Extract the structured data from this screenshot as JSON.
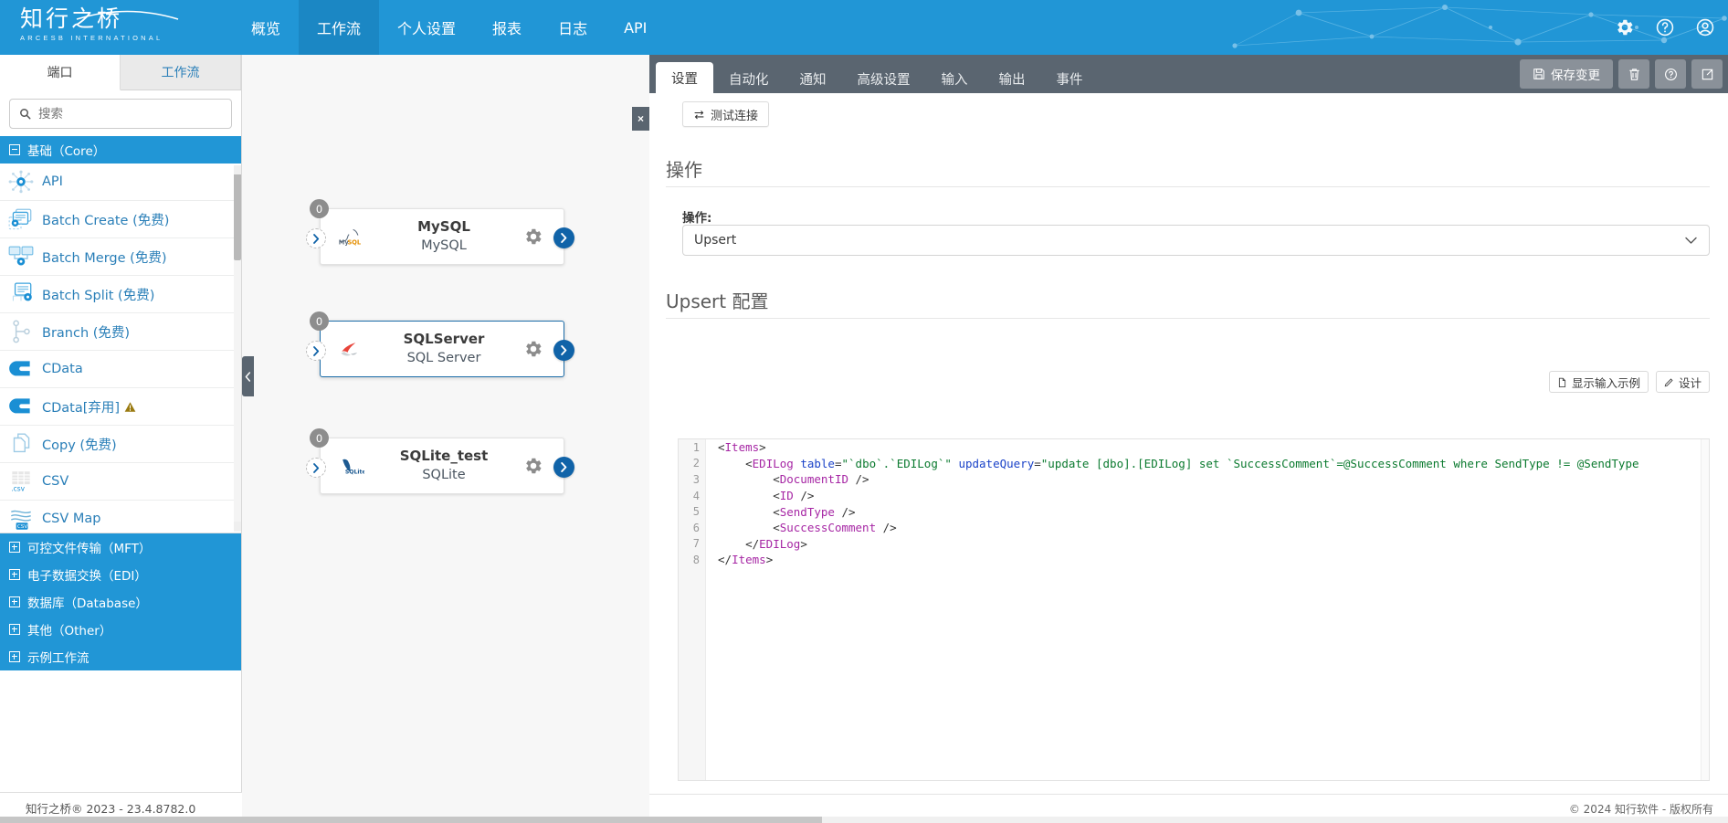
{
  "topnav": {
    "brand_cn": "知行之桥",
    "brand_en": "ARCESB INTERNATIONAL",
    "items": [
      {
        "label": "概览",
        "active": false
      },
      {
        "label": "工作流",
        "active": true
      },
      {
        "label": "个人设置",
        "active": false
      },
      {
        "label": "报表",
        "active": false
      },
      {
        "label": "日志",
        "active": false
      },
      {
        "label": "API",
        "active": false
      }
    ],
    "icons": [
      "gear-icon",
      "help-icon",
      "account-icon"
    ]
  },
  "sidebar": {
    "tabs": [
      {
        "label": "端口",
        "active": true
      },
      {
        "label": "工作流",
        "active": false
      }
    ],
    "search": {
      "value": "",
      "placeholder": "搜索"
    },
    "core_category": "基础（Core）",
    "connectors": [
      {
        "label": "API",
        "icon": "api-icon",
        "warn": false
      },
      {
        "label": "Batch Create (免费)",
        "icon": "batch-create-icon",
        "warn": false
      },
      {
        "label": "Batch Merge (免费)",
        "icon": "batch-merge-icon",
        "warn": false
      },
      {
        "label": "Batch Split (免费)",
        "icon": "batch-split-icon",
        "warn": false
      },
      {
        "label": "Branch (免费)",
        "icon": "branch-icon",
        "warn": false
      },
      {
        "label": "CData",
        "icon": "cdata-icon",
        "warn": false
      },
      {
        "label": "CData[弃用]",
        "icon": "cdata-icon",
        "warn": true
      },
      {
        "label": "Copy (免费)",
        "icon": "copy-icon",
        "warn": false
      },
      {
        "label": "CSV",
        "icon": "csv-icon",
        "warn": false
      },
      {
        "label": "CSV Map",
        "icon": "csv-map-icon",
        "warn": false
      }
    ],
    "categories": [
      "可控文件传输（MFT）",
      "电子数据交换（EDI）",
      "数据库（Database）",
      "其他（Other）",
      "示例工作流"
    ],
    "footer": "知行之桥® 2023 - 23.4.8782.0"
  },
  "canvas": {
    "close_label": "×",
    "nodes": [
      {
        "badge": "0",
        "title": "MySQL",
        "subtitle": "MySQL",
        "icon": "mysql-icon",
        "selected": false
      },
      {
        "badge": "0",
        "title": "SQLServer",
        "subtitle": "SQL Server",
        "icon": "sqlserver-icon",
        "selected": true
      },
      {
        "badge": "0",
        "title": "SQLite_test",
        "subtitle": "SQLite",
        "icon": "sqlite-icon",
        "selected": false
      }
    ]
  },
  "panel": {
    "tabs": [
      {
        "label": "设置",
        "active": true
      },
      {
        "label": "自动化",
        "active": false
      },
      {
        "label": "通知",
        "active": false
      },
      {
        "label": "高级设置",
        "active": false
      },
      {
        "label": "输入",
        "active": false
      },
      {
        "label": "输出",
        "active": false
      },
      {
        "label": "事件",
        "active": false
      }
    ],
    "save_label": "保存变更",
    "tool_icons": [
      "trash-icon",
      "help-icon",
      "export-icon"
    ],
    "test_connection_label": "测试连接",
    "action_section_title": "操作",
    "action_field_label": "操作:",
    "action_value": "Upsert",
    "upsert_section_title": "Upsert 配置",
    "show_input_sample_label": "显示输入示例",
    "design_label": "设计",
    "code": [
      {
        "n": "1",
        "tokens": [
          {
            "t": "punc",
            "v": "<"
          },
          {
            "t": "tag",
            "v": "Items"
          },
          {
            "t": "punc",
            "v": ">"
          }
        ]
      },
      {
        "n": "2",
        "tokens": [
          {
            "t": "punc",
            "v": "    <"
          },
          {
            "t": "tag",
            "v": "EDILog"
          },
          {
            "t": "punc",
            "v": " "
          },
          {
            "t": "attr",
            "v": "table"
          },
          {
            "t": "punc",
            "v": "="
          },
          {
            "t": "str",
            "v": "\"`dbo`.`EDILog`\""
          },
          {
            "t": "punc",
            "v": " "
          },
          {
            "t": "attr",
            "v": "updateQuery"
          },
          {
            "t": "punc",
            "v": "="
          },
          {
            "t": "str",
            "v": "\"update [dbo].[EDILog] set `SuccessComment`=@SuccessComment where SendType != @SendType"
          }
        ]
      },
      {
        "n": "3",
        "tokens": [
          {
            "t": "punc",
            "v": "        <"
          },
          {
            "t": "tag",
            "v": "DocumentID"
          },
          {
            "t": "punc",
            "v": " />"
          }
        ]
      },
      {
        "n": "4",
        "tokens": [
          {
            "t": "punc",
            "v": "        <"
          },
          {
            "t": "tag",
            "v": "ID"
          },
          {
            "t": "punc",
            "v": " />"
          }
        ]
      },
      {
        "n": "5",
        "tokens": [
          {
            "t": "punc",
            "v": "        <"
          },
          {
            "t": "tag",
            "v": "SendType"
          },
          {
            "t": "punc",
            "v": " />"
          }
        ]
      },
      {
        "n": "6",
        "tokens": [
          {
            "t": "punc",
            "v": "        <"
          },
          {
            "t": "tag",
            "v": "SuccessComment"
          },
          {
            "t": "punc",
            "v": " />"
          }
        ]
      },
      {
        "n": "7",
        "tokens": [
          {
            "t": "punc",
            "v": "    </"
          },
          {
            "t": "tag",
            "v": "EDILog"
          },
          {
            "t": "punc",
            "v": ">"
          }
        ]
      },
      {
        "n": "8",
        "tokens": [
          {
            "t": "punc",
            "v": "</"
          },
          {
            "t": "tag",
            "v": "Items"
          },
          {
            "t": "punc",
            "v": ">"
          }
        ]
      }
    ],
    "footer": "© 2024 知行软件 - 版权所有"
  },
  "colors": {
    "brand_blue": "#2196d6",
    "nav_active": "#1b87c4",
    "panel_dark": "#5a6570",
    "link_blue": "#2a7fb8",
    "select_border": "#1b6ca8"
  }
}
